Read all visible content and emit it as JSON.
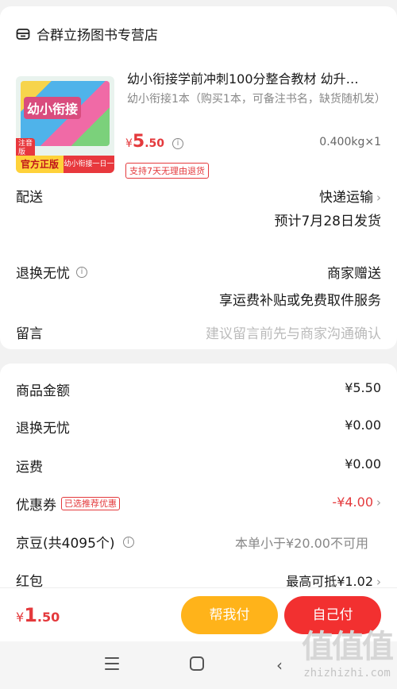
{
  "store": {
    "name": "合群立扬图书专营店",
    "icon": "store-icon"
  },
  "product": {
    "title": "幼小衔接学前冲刺100分整合教材 幼升…",
    "spec": "幼小衔接1本（购买1本，可备注书名，缺货随机发）",
    "price_symbol": "¥",
    "price_int": "5",
    "price_dec": ".50",
    "weight_qty": "0.400kg×1",
    "return_badge": "支持7天无理由退货",
    "thumb": {
      "book_title": "幼小衔接",
      "pinyin_tag": "注音版",
      "official": "官方正版",
      "practice": "幼小衔接一日一练"
    }
  },
  "delivery": {
    "label": "配送",
    "method": "快递运输",
    "eta": "预计7月28日发货"
  },
  "return_worry": {
    "label": "退换无忧",
    "value": "商家赠送",
    "sub": "享运费补贴或免费取件服务"
  },
  "message": {
    "label": "留言",
    "placeholder": "建议留言前先与商家沟通确认"
  },
  "summary": {
    "items": [
      {
        "label": "商品金额",
        "value": "¥5.50"
      },
      {
        "label": "退换无忧",
        "value": "¥0.00"
      },
      {
        "label": "运费",
        "value": "¥0.00"
      },
      {
        "label": "优惠券",
        "tag": "已选推荐优惠",
        "value": "-¥4.00"
      },
      {
        "label": "京豆(共4095个)",
        "value": "本单小于¥20.00不可用"
      },
      {
        "label": "红包",
        "value": "最高可抵¥1.02"
      }
    ]
  },
  "footer": {
    "total_symbol": "¥",
    "total_int": "1",
    "total_dec": ".50",
    "help_pay": "帮我付",
    "self_pay": "自己付"
  },
  "watermark": {
    "glyphs": "值值值",
    "text": "zhizhizhi.com"
  },
  "colors": {
    "accent": "#e4393c",
    "help_button": "#ffb31a",
    "pay_button": "#f23030"
  }
}
